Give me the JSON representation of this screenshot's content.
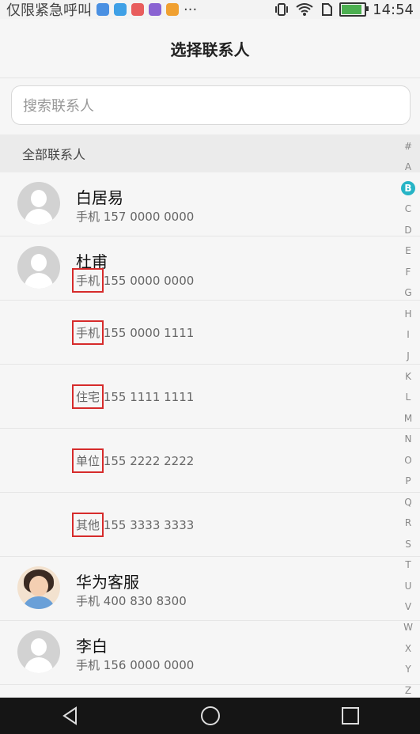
{
  "status": {
    "carrier": "仅限紧急呼叫",
    "more": "···",
    "time": "14:54",
    "app_icons": [
      {
        "name": "app-icon-1",
        "color": "#4a90e2"
      },
      {
        "name": "app-icon-2",
        "color": "#3fa0e6"
      },
      {
        "name": "app-icon-3",
        "color": "#e85d5d"
      },
      {
        "name": "app-icon-4",
        "color": "#8a63d2"
      },
      {
        "name": "app-icon-5",
        "color": "#f0a030"
      }
    ],
    "battery_color": "#4caf50"
  },
  "header": {
    "title": "选择联系人"
  },
  "search": {
    "placeholder": "搜索联系人"
  },
  "section": {
    "label": "全部联系人"
  },
  "contacts": [
    {
      "name": "白居易",
      "type": "手机",
      "number": "157 0000 0000"
    },
    {
      "name": "杜甫",
      "type": "手机",
      "number": "155 0000 0000"
    },
    {
      "type": "手机",
      "number": "155 0000 1111"
    },
    {
      "type": "住宅",
      "number": "155 1111 1111"
    },
    {
      "type": "单位",
      "number": "155 2222 2222"
    },
    {
      "type": "其他",
      "number": "155 3333 3333"
    },
    {
      "name": "华为客服",
      "type": "手机",
      "number": "400 830 8300"
    },
    {
      "name": "李白",
      "type": "手机",
      "number": "156 0000 0000"
    }
  ],
  "index": [
    "#",
    "A",
    "B",
    "C",
    "D",
    "E",
    "F",
    "G",
    "H",
    "I",
    "J",
    "K",
    "L",
    "M",
    "N",
    "O",
    "P",
    "Q",
    "R",
    "S",
    "T",
    "U",
    "V",
    "W",
    "X",
    "Y",
    "Z"
  ],
  "index_active": "B",
  "accent": "#27b4c6",
  "highlight": "#d62b2b",
  "nav": {
    "buttons": [
      "back-icon",
      "home-icon",
      "recents-icon"
    ]
  }
}
